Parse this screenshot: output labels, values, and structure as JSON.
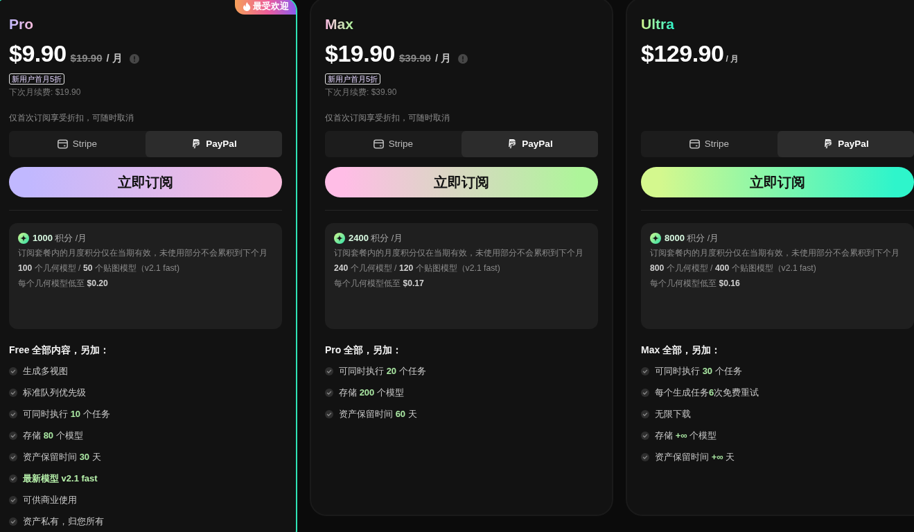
{
  "plans": [
    {
      "name": "Pro",
      "gradient": [
        {
          "color": "#c1b8ff"
        },
        {
          "color": "#f8bcdd"
        }
      ],
      "featured": true,
      "badge": "最受欢迎",
      "price": "$9.90",
      "original_price": "$19.90",
      "period": "/ 月",
      "info_hint": true,
      "promo_tag": "新用户首月5折",
      "renewal": "下次月续费: $19.90",
      "note": "仅首次订阅享受折扣，可随时取消",
      "payment_methods": [
        {
          "label": "Stripe",
          "selected": false
        },
        {
          "label": "PayPal",
          "selected": true
        }
      ],
      "subscribe": "立即订阅",
      "credits": {
        "headline": "**1000** 积分 /月",
        "lines": [
          "订阅套餐内的月度积分仅在当期有效，未使用部分不会累积到下个月",
          "**100** 个几何模型 / **50** 个贴图模型（v2.1 fast)",
          "每个几何模型低至 **$0.20**"
        ]
      },
      "features_title": "Free 全部内容，另加：",
      "features": [
        {
          "text": "生成多视图",
          "highlight": false
        },
        {
          "text": "标准队列优先级",
          "highlight": false
        },
        {
          "text": "可同时执行 **10** 个任务",
          "highlight": false
        },
        {
          "text": "存储 **80** 个模型",
          "highlight": false
        },
        {
          "text": "资产保留时间 **30** 天",
          "highlight": false
        },
        {
          "text": "最新模型 v2.1 fast",
          "highlight": true
        },
        {
          "text": "可供商业使用",
          "highlight": false
        },
        {
          "text": "资产私有，归您所有",
          "highlight": false
        }
      ]
    },
    {
      "name": "Max",
      "gradient": [
        {
          "color": "#ffbde6"
        },
        {
          "color": "#aef59a"
        }
      ],
      "featured": false,
      "price": "$19.90",
      "original_price": "$39.90",
      "period": "/ 月",
      "info_hint": true,
      "promo_tag": "新用户首月5折",
      "renewal": "下次月续费: $39.90",
      "note": "仅首次订阅享受折扣，可随时取消",
      "payment_methods": [
        {
          "label": "Stripe",
          "selected": false
        },
        {
          "label": "PayPal",
          "selected": true
        }
      ],
      "subscribe": "立即订阅",
      "credits": {
        "headline": "**2400** 积分 /月",
        "lines": [
          "订阅套餐内的月度积分仅在当期有效，未使用部分不会累积到下个月",
          "**240** 个几何模型 / **120** 个贴图模型（v2.1 fast)",
          "每个几何模型低至 **$0.17**"
        ]
      },
      "features_title": "Pro 全部，另加：",
      "features": [
        {
          "text": "可同时执行 **20** 个任务",
          "highlight": false
        },
        {
          "text": "存储 **200** 个模型",
          "highlight": false
        },
        {
          "text": "资产保留时间 **60** 天",
          "highlight": false
        }
      ]
    },
    {
      "name": "Ultra",
      "gradient": [
        {
          "color": "#d4f88e"
        },
        {
          "color": "#2ef5cb"
        }
      ],
      "featured": false,
      "price": "$129.90",
      "period": "/ 月",
      "info_hint": false,
      "payment_methods": [
        {
          "label": "Stripe",
          "selected": false
        },
        {
          "label": "PayPal",
          "selected": true
        }
      ],
      "subscribe": "立即订阅",
      "credits": {
        "headline": "**8000** 积分 /月",
        "lines": [
          "订阅套餐内的月度积分仅在当期有效，未使用部分不会累积到下个月",
          "**800** 个几何模型 / **400** 个贴图模型（v2.1 fast)",
          "每个几何模型低至 **$0.16**"
        ]
      },
      "features_title": "Max 全部，另加：",
      "features": [
        {
          "text": "可同时执行 **30** 个任务",
          "highlight": false
        },
        {
          "text": "每个生成任务**6**次免费重试",
          "highlight": false
        },
        {
          "text": "无限下载",
          "highlight": false
        },
        {
          "text": "存储 **+∞** 个模型",
          "highlight": false
        },
        {
          "text": "资产保留时间 **+∞** 天",
          "highlight": false
        }
      ]
    }
  ]
}
